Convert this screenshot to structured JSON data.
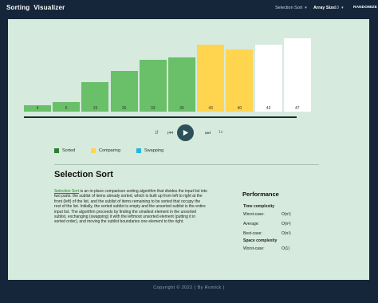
{
  "nav": {
    "brand": "Sorting  Visualizer",
    "algorithm": "Selection Sort",
    "array_size_label": "Array Size",
    "array_size_value": "10",
    "randomize": "RANDOMIZE"
  },
  "colors": {
    "sorted": "#6abf69",
    "comparing": "#ffd54f",
    "swapping": "#26b6e0",
    "unsorted": "#ffffff"
  },
  "bars": [
    {
      "value": 4,
      "state": "sorted"
    },
    {
      "value": 6,
      "state": "sorted"
    },
    {
      "value": 19,
      "state": "sorted"
    },
    {
      "value": 26,
      "state": "sorted"
    },
    {
      "value": 33,
      "state": "sorted"
    },
    {
      "value": 35,
      "state": "sorted"
    },
    {
      "value": 43,
      "state": "comparing"
    },
    {
      "value": 40,
      "state": "comparing"
    },
    {
      "value": 43,
      "state": "unsorted"
    },
    {
      "value": 47,
      "state": "unsorted"
    }
  ],
  "controls": {
    "slower_icon": "0.5x-icon",
    "prev_icon": "skip-back-icon",
    "play_icon": "play-icon",
    "next_icon": "skip-forward-icon",
    "faster_icon": "1x-icon",
    "slower_text": "1x",
    "faster_text": "1x"
  },
  "legend": [
    {
      "label": "Sorted",
      "color": "#2e7d32"
    },
    {
      "label": "Comparing",
      "color": "#ffd54f"
    },
    {
      "label": "Swapping",
      "color": "#26b6e0"
    }
  ],
  "description": {
    "title": "Selection Sort",
    "link_text": "Selection Sort",
    "body": " is an in-place comparison sorting algorithm that divides the input list into two parts: the sublist of items already sorted, which is built up from left to right at the front (left) of the list, and the sublist of items remaining to be sorted that occupy the rest of the list. Initially, the sorted sublist is empty and the unsorted sublist is the entire input list. The algorithm proceeds by finding the smallest element in the unsorted sublist, exchanging (swapping) it with the leftmost unsorted element (putting it in sorted order), and moving the sublist boundaries one element to the right."
  },
  "performance": {
    "title": "Performance",
    "time_heading": "Time complexity",
    "worst_label": "Worst-case:",
    "worst_value": "O(n²)",
    "average_label": "Average:",
    "average_value": "O(n²)",
    "best_label": "Best-case:",
    "best_value": "O(n²)",
    "space_heading": "Space complexity",
    "space_worst_label": "Worst-case:",
    "space_worst_value": "O(1)"
  },
  "footer": "Copyright © 2022 ( By Romick )"
}
